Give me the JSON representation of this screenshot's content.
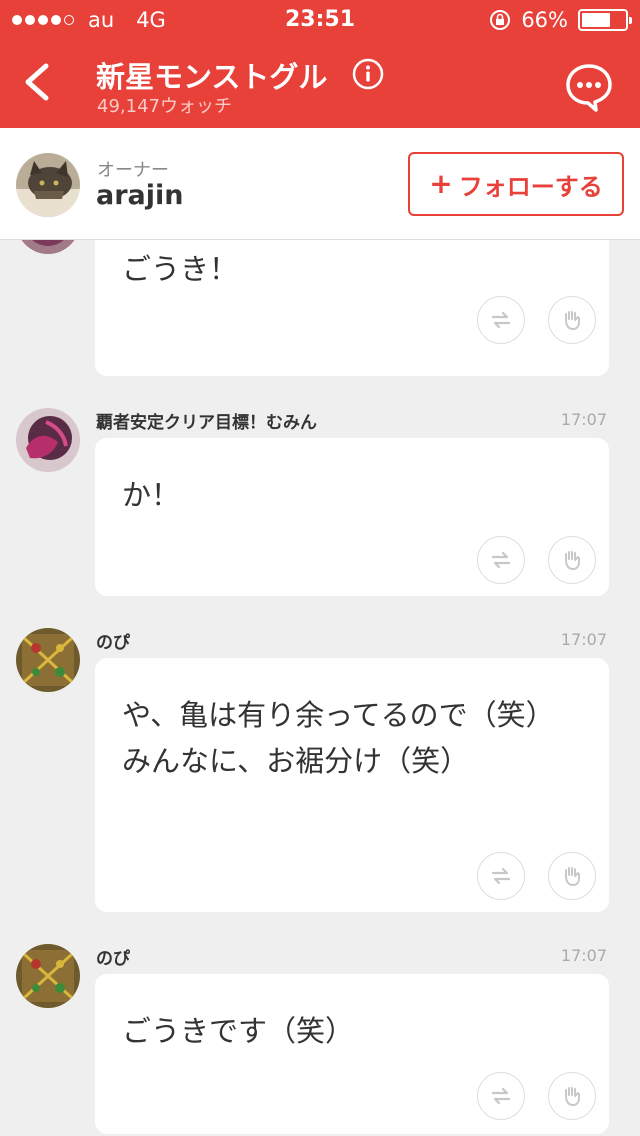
{
  "status": {
    "carrier": "au",
    "network": "4G",
    "time": "23:51",
    "battery": "66%",
    "battery_level": 0.66
  },
  "nav": {
    "title": "新星モンストグル",
    "watch_count": "49,147ウォッチ",
    "back_icon": "chevron-left-icon",
    "info_icon": "info-icon",
    "chat_icon": "speech-bubble-icon"
  },
  "owner": {
    "role": "オーナー",
    "name": "arajin",
    "follow_plus": "+",
    "follow_label": "フォローする"
  },
  "messages": [
    {
      "sender": "",
      "time": "",
      "text": "ごうき！"
    },
    {
      "sender": "覇者安定クリア目標！むみん",
      "time": "17:07",
      "text": "か！"
    },
    {
      "sender": "のぴ",
      "time": "17:07",
      "text": "や、亀は有り余ってるので（笑）\nみんなに、お裾分け（笑）"
    },
    {
      "sender": "のぴ",
      "time": "17:07",
      "text": "ごうきです（笑）"
    }
  ],
  "colors": {
    "brand": "#e8413a",
    "background": "#efefef",
    "bubble": "#ffffff"
  }
}
